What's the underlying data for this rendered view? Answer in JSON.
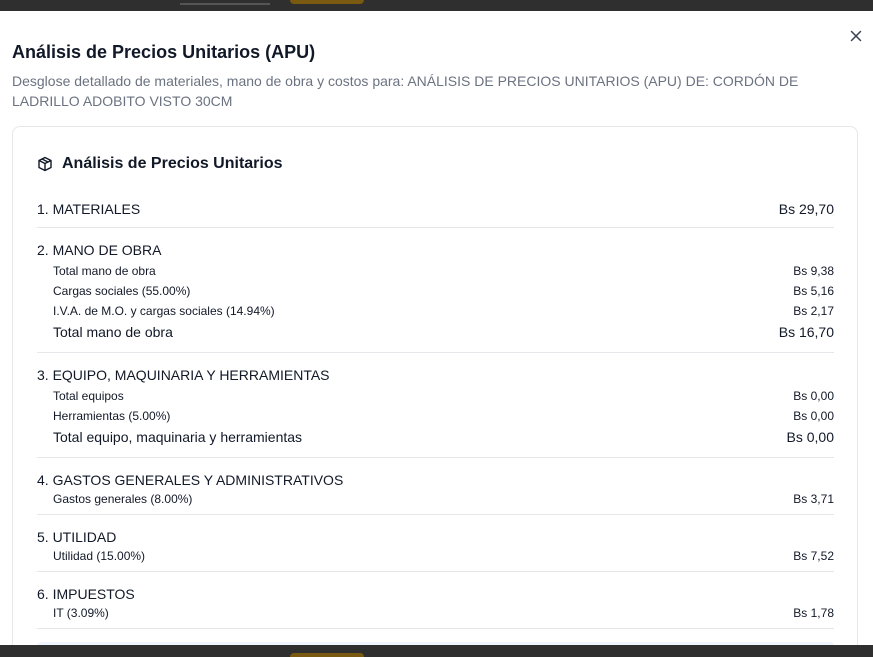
{
  "dialog": {
    "title": "Análisis de Precios Unitarios (APU)",
    "description": "Desglose detallado de materiales, mano de obra y costos para: ANÁLISIS DE PRECIOS UNITARIOS (APU) DE: CORDÓN DE LADRILLO ADOBITO VISTO 30CM",
    "close_icon": "close-icon"
  },
  "card": {
    "title": "Análisis de Precios Unitarios",
    "icon": "package-icon"
  },
  "sections": [
    {
      "label": "1. MATERIALES",
      "amount": "Bs 29,70"
    },
    {
      "label": "2. MANO DE OBRA",
      "items": [
        {
          "label": "Total mano de obra",
          "amount": "Bs 9,38"
        },
        {
          "label": "Cargas sociales (55.00%)",
          "amount": "Bs 5,16"
        },
        {
          "label": "I.V.A. de M.O. y cargas sociales (14.94%)",
          "amount": "Bs 2,17"
        }
      ],
      "total": {
        "label": "Total mano de obra",
        "amount": "Bs 16,70"
      }
    },
    {
      "label": "3. EQUIPO, MAQUINARIA Y HERRAMIENTAS",
      "items": [
        {
          "label": "Total equipos",
          "amount": "Bs 0,00"
        },
        {
          "label": "Herramientas (5.00%)",
          "amount": "Bs 0,00"
        }
      ],
      "total": {
        "label": "Total equipo, maquinaria y herramientas",
        "amount": "Bs 0,00"
      }
    },
    {
      "label": "4. GASTOS GENERALES Y ADMINISTRATIVOS",
      "items": [
        {
          "label": "Gastos generales (8.00%)",
          "amount": "Bs 3,71"
        }
      ]
    },
    {
      "label": "5. UTILIDAD",
      "items": [
        {
          "label": "Utilidad (15.00%)",
          "amount": "Bs 7,52"
        }
      ]
    },
    {
      "label": "6. IMPUESTOS",
      "items": [
        {
          "label": "IT (3.09%)",
          "amount": "Bs 1,78"
        }
      ]
    }
  ]
}
